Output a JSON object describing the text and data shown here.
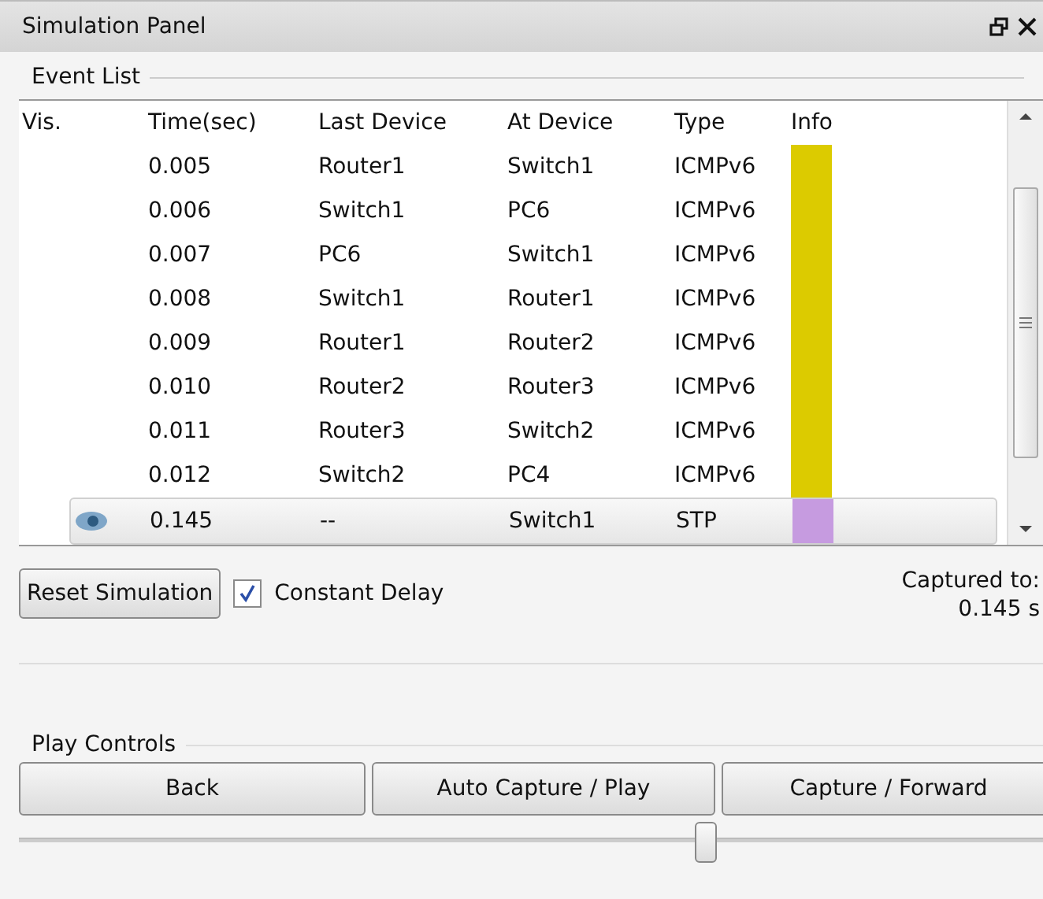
{
  "window": {
    "title": "Simulation Panel"
  },
  "event_list": {
    "label": "Event List",
    "columns": [
      "Vis.",
      "Time(sec)",
      "Last Device",
      "At Device",
      "Type",
      "Info"
    ],
    "rows": [
      {
        "visible": false,
        "time": "0.005",
        "last_device": "Router1",
        "at_device": "Switch1",
        "type": "ICMPv6",
        "color": "#dccb00",
        "selected": false
      },
      {
        "visible": false,
        "time": "0.006",
        "last_device": "Switch1",
        "at_device": "PC6",
        "type": "ICMPv6",
        "color": "#dccb00",
        "selected": false
      },
      {
        "visible": false,
        "time": "0.007",
        "last_device": "PC6",
        "at_device": "Switch1",
        "type": "ICMPv6",
        "color": "#dccb00",
        "selected": false
      },
      {
        "visible": false,
        "time": "0.008",
        "last_device": "Switch1",
        "at_device": "Router1",
        "type": "ICMPv6",
        "color": "#dccb00",
        "selected": false
      },
      {
        "visible": false,
        "time": "0.009",
        "last_device": "Router1",
        "at_device": "Router2",
        "type": "ICMPv6",
        "color": "#dccb00",
        "selected": false
      },
      {
        "visible": false,
        "time": "0.010",
        "last_device": "Router2",
        "at_device": "Router3",
        "type": "ICMPv6",
        "color": "#dccb00",
        "selected": false
      },
      {
        "visible": false,
        "time": "0.011",
        "last_device": "Router3",
        "at_device": "Switch2",
        "type": "ICMPv6",
        "color": "#dccb00",
        "selected": false
      },
      {
        "visible": false,
        "time": "0.012",
        "last_device": "Switch2",
        "at_device": "PC4",
        "type": "ICMPv6",
        "color": "#dccb00",
        "selected": false
      },
      {
        "visible": true,
        "time": "0.145",
        "last_device": "--",
        "at_device": "Switch1",
        "type": "STP",
        "color": "#c69be0",
        "selected": true
      }
    ]
  },
  "reset_button": "Reset Simulation",
  "constant_delay": {
    "label": "Constant Delay",
    "checked": true
  },
  "captured": {
    "label": "Captured to:",
    "value": "0.145 s"
  },
  "play_controls": {
    "label": "Play Controls",
    "buttons": [
      "Back",
      "Auto Capture / Play",
      "Capture / Forward"
    ],
    "slider": {
      "level": 0.67
    }
  }
}
